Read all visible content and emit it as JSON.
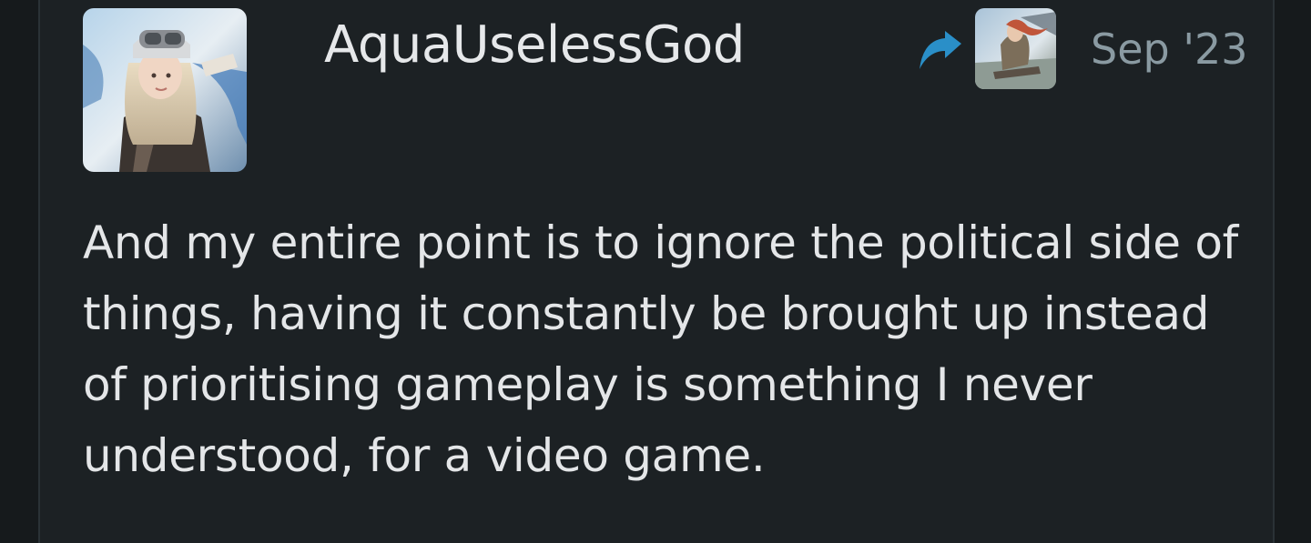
{
  "post": {
    "username": "AquaUselessGod",
    "date": "Sep '23",
    "body_lines": [
      "And my entire point is to ignore the political side of",
      "things, having it constantly be brought up instead",
      "of prioritising gameplay is something I never",
      "understood, for a video game."
    ],
    "reply_icon": "reply-arrow-icon",
    "colors": {
      "background": "#1c2124",
      "username": "#e6e8ea",
      "date": "#8a9aa2",
      "reply_icon": "#2a8fc8",
      "body_text": "#e4e6e8"
    }
  }
}
